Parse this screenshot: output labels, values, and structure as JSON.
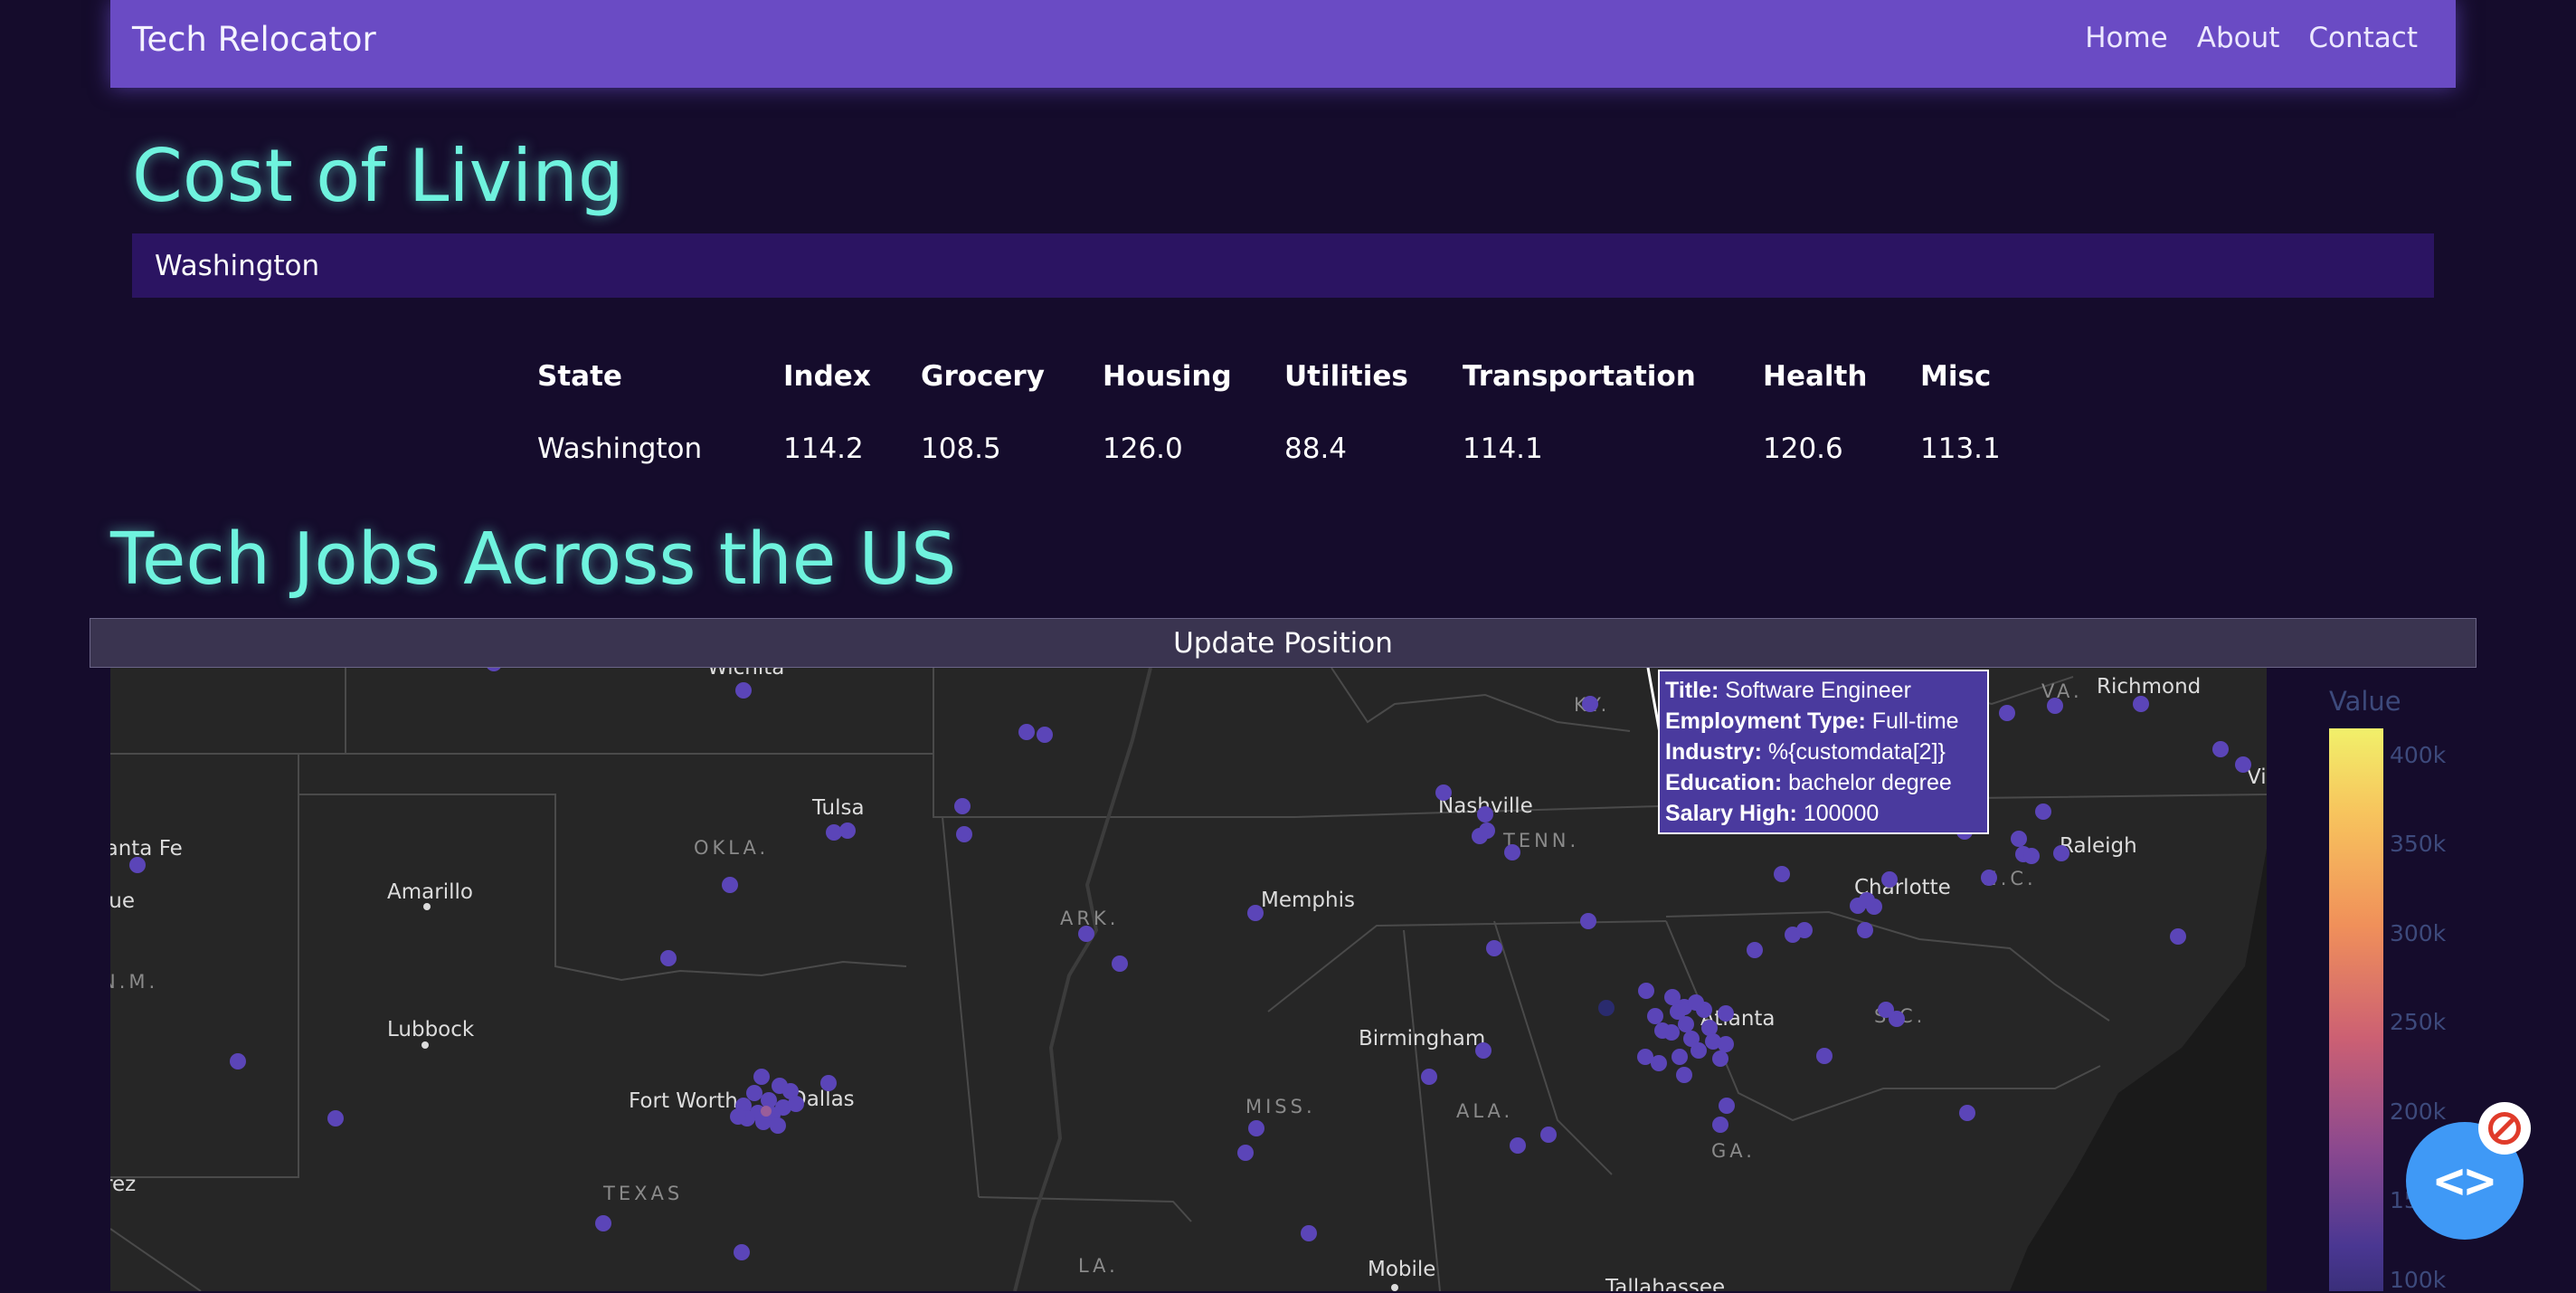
{
  "navbar": {
    "brand": "Tech Relocator",
    "links": [
      "Home",
      "About",
      "Contact"
    ]
  },
  "cost_section": {
    "title": "Cost of Living",
    "selected_state": "Washington",
    "headers": [
      "State",
      "Index",
      "Grocery",
      "Housing",
      "Utilities",
      "Transportation",
      "Health",
      "Misc"
    ],
    "row": [
      "Washington",
      "114.2",
      "108.5",
      "126.0",
      "88.4",
      "114.1",
      "120.6",
      "113.1"
    ]
  },
  "jobs_section": {
    "title": "Tech Jobs Across the US",
    "update_button": "Update Position"
  },
  "map": {
    "cities": [
      "Wichita",
      "Tulsa",
      "Nashville",
      "Richmond",
      "Santa Fe",
      "Albuquerque",
      "Amarillo",
      "Raleigh",
      "Charlotte",
      "Memphis",
      "Lubbock",
      "Birmingham",
      "Atlanta",
      "Fort Worth",
      "Dallas",
      "Ciudad Juárez",
      "Mobile",
      "Tallahassee",
      "Virginia Beach"
    ],
    "state_labels": [
      "KY.",
      "VA.",
      "OKLA.",
      "TENN.",
      "N.C.",
      "ARK.",
      "N.M.",
      "S.C.",
      "MISS.",
      "ALA.",
      "GA.",
      "TEXAS",
      "LA."
    ],
    "marker_color": "#5b45b8"
  },
  "tooltip": {
    "rows": [
      {
        "label": "Title:",
        "value": "Software Engineer"
      },
      {
        "label": "Employment Type:",
        "value": "Full-time"
      },
      {
        "label": "Industry:",
        "value": "%{customdata[2]}"
      },
      {
        "label": "Education:",
        "value": "bachelor degree"
      },
      {
        "label": "Salary High:",
        "value": "100000"
      }
    ]
  },
  "colorbar": {
    "title": "Value",
    "ticks": [
      "400k",
      "350k",
      "300k",
      "250k",
      "200k",
      "150k",
      "100k"
    ],
    "colors": [
      "#f1f06a",
      "#f0905a",
      "#cc6073",
      "#4a3792"
    ]
  },
  "fab": {
    "icon": "code-icon"
  },
  "badge": {
    "icon": "no-entry-icon"
  }
}
